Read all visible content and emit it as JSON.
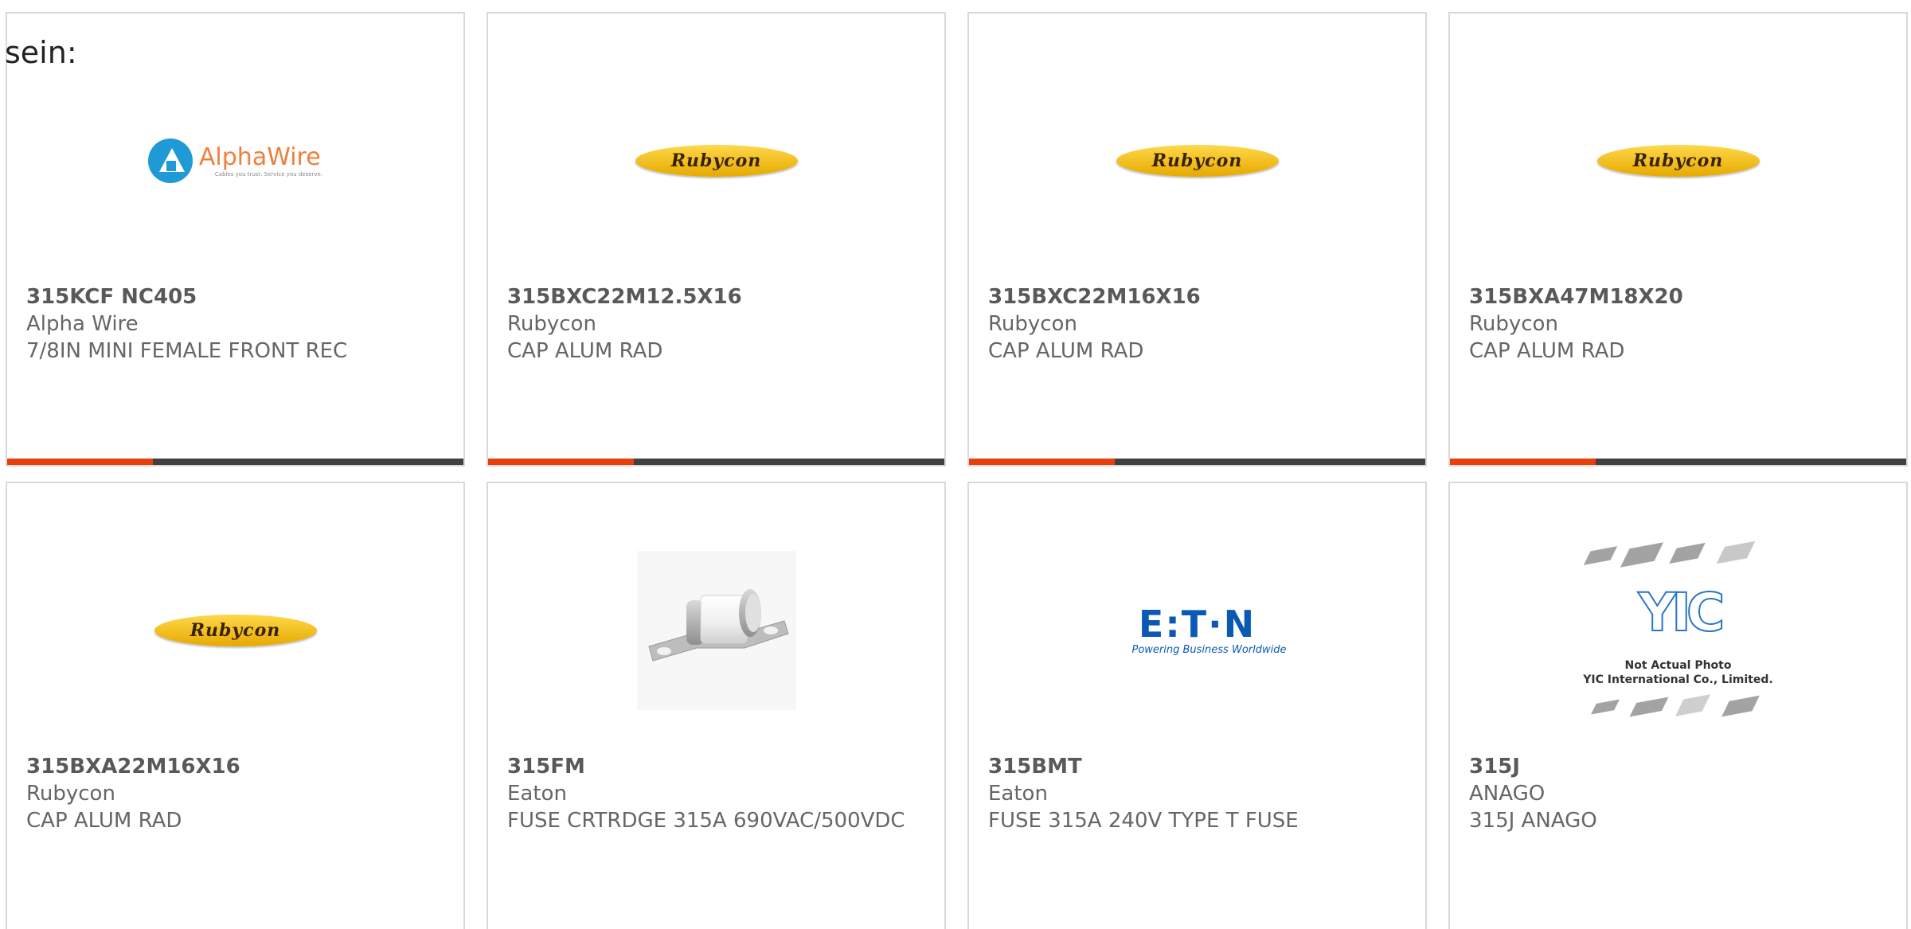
{
  "intro_text": "sein:",
  "colors": {
    "accent_bar": "#e8400c",
    "dark_bar": "#404040",
    "card_border": "#d9d9d9",
    "text": "#666666"
  },
  "products": [
    {
      "part_number": "315KCF NC405",
      "manufacturer": "Alpha Wire",
      "description": "7/8IN MINI FEMALE FRONT REC",
      "logo": {
        "name": "AlphaWire",
        "tagline": "Cables you trust. Service you deserve."
      }
    },
    {
      "part_number": "315BXC22M12.5X16",
      "manufacturer": "Rubycon",
      "description": "CAP ALUM RAD",
      "logo": {
        "name": "Rubycon"
      }
    },
    {
      "part_number": "315BXC22M16X16",
      "manufacturer": "Rubycon",
      "description": "CAP ALUM RAD",
      "logo": {
        "name": "Rubycon"
      }
    },
    {
      "part_number": "315BXA47M18X20",
      "manufacturer": "Rubycon",
      "description": "CAP ALUM RAD",
      "logo": {
        "name": "Rubycon"
      }
    },
    {
      "part_number": "315BXA22M16X16",
      "manufacturer": "Rubycon",
      "description": "CAP ALUM RAD",
      "logo": {
        "name": "Rubycon"
      }
    },
    {
      "part_number": "315FM",
      "manufacturer": "Eaton",
      "description": "FUSE CRTRDGE 315A 690VAC/500VDC",
      "image": "fuse-photo"
    },
    {
      "part_number": "315BMT",
      "manufacturer": "Eaton",
      "description": "FUSE 315A 240V TYPE T FUSE",
      "logo": {
        "name": "E:T·N",
        "tagline": "Powering Business Worldwide"
      }
    },
    {
      "part_number": "315J",
      "manufacturer": "ANAGO",
      "description": "315J ANAGO",
      "image": {
        "logo_text": "YIC",
        "note_line1": "Not Actual Photo",
        "note_line2": "YIC International Co., Limited."
      }
    }
  ]
}
